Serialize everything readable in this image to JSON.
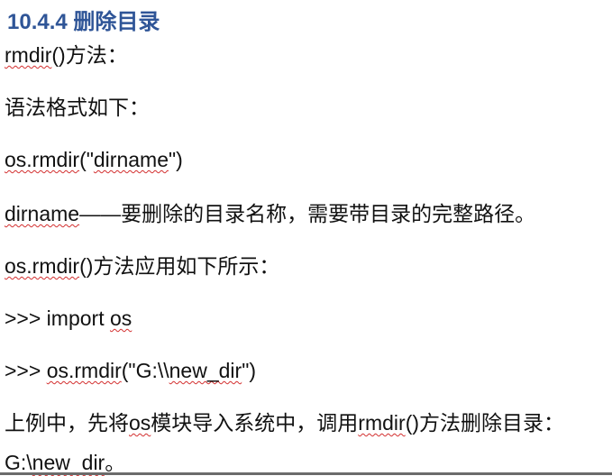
{
  "heading": "10.4.4 删除目录",
  "lines": {
    "l1": {
      "a": "rmdir",
      "b": "()方法："
    },
    "l2": {
      "a": "语法格式如下："
    },
    "l3": {
      "a": "os.rmdir",
      "b": "(\"",
      "c": "dirname",
      "d": "\")"
    },
    "l4": {
      "a": "dirname",
      "b": "——要删除的目录名称，需要带目录的完整路径。"
    },
    "l5": {
      "a": "os.rmdir",
      "b": "()方法应用如下所示："
    },
    "l6": {
      "a": ">>> import ",
      "b": "os"
    },
    "l7": {
      "a": ">>> ",
      "b": "os.rmdir",
      "c": "(\"G:\\\\",
      "d": "new_dir",
      "e": "\")"
    },
    "l8": {
      "a": "上例中，先将",
      "b": "os",
      "c": "模块导入系统中，调用",
      "d": "rmdir",
      "e": "()方法删除目录："
    },
    "l9": {
      "a": "G:\\",
      "b": "new_dir",
      "c": "。"
    }
  },
  "colors": {
    "heading": "#2f5597",
    "spellcheck_underline": "#d32f2f",
    "text": "#111111"
  }
}
